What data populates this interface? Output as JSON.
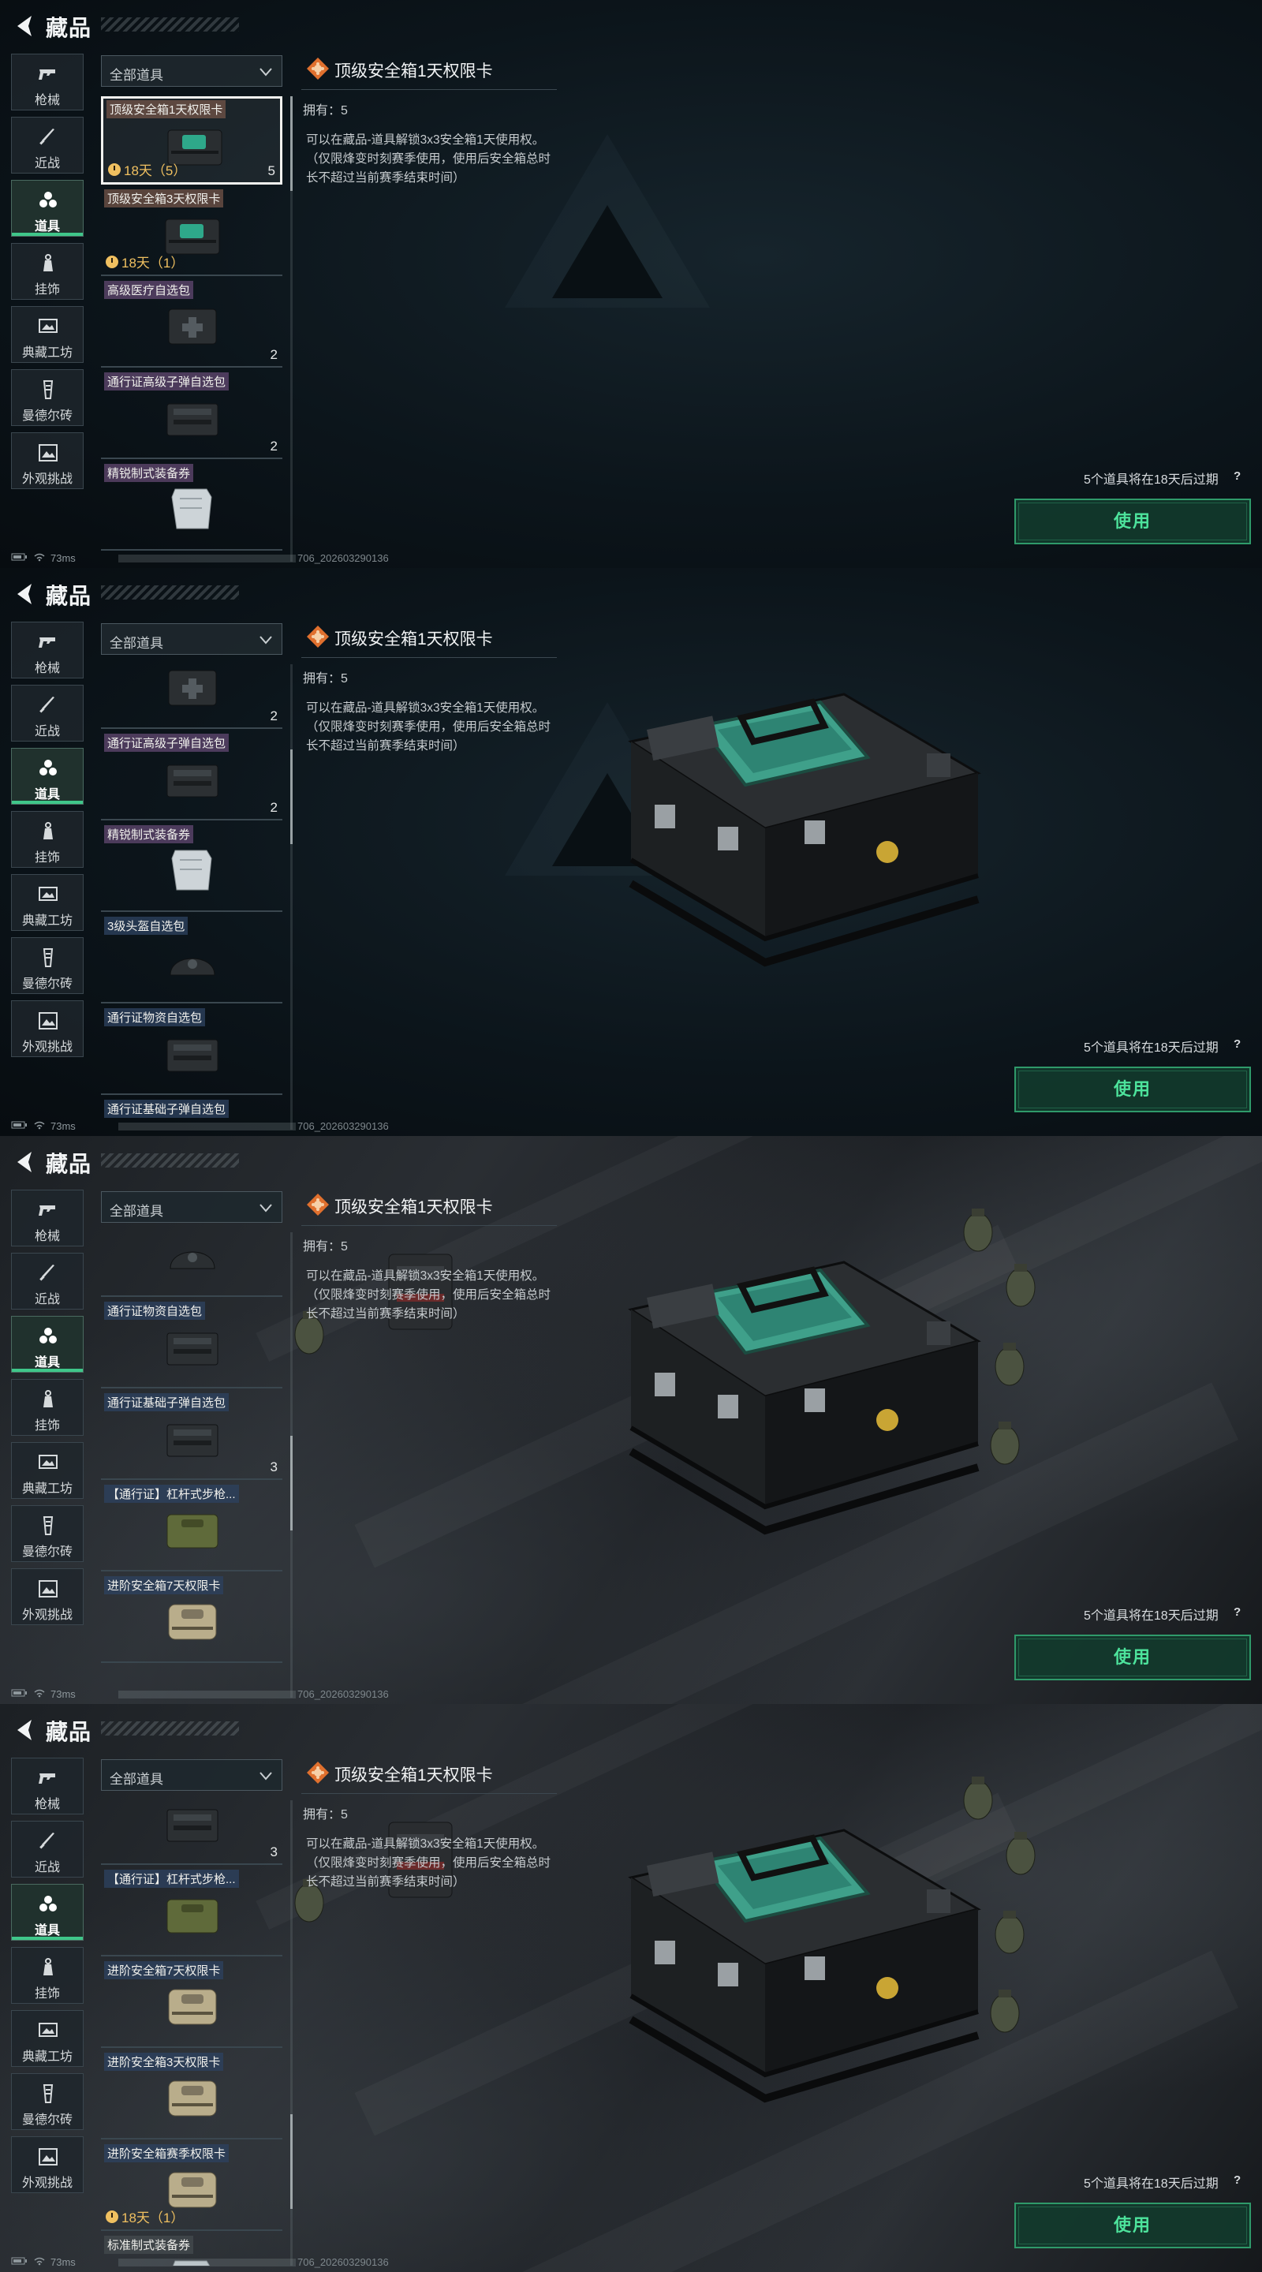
{
  "header": {
    "title": "藏品"
  },
  "categories": [
    {
      "label": "枪械",
      "icon": "gun-icon"
    },
    {
      "label": "近战",
      "icon": "knife-icon"
    },
    {
      "label": "道具",
      "icon": "items-icon",
      "active": true
    },
    {
      "label": "挂饰",
      "icon": "charm-icon"
    },
    {
      "label": "典藏工坊",
      "icon": "workshop-icon"
    },
    {
      "label": "曼德尔砖",
      "icon": "mandel-brick-icon"
    },
    {
      "label": "外观挑战",
      "icon": "appearance-challenge-icon"
    }
  ],
  "filter": {
    "label": "全部道具"
  },
  "detail": {
    "title": "顶级安全箱1天权限卡",
    "own": "拥有：5",
    "description": "可以在藏品-道具解锁3x3安全箱1天使用权。（仅限烽变时刻赛季使用，使用后安全箱总时长不超过当前赛季结束时间）"
  },
  "footer": {
    "expire_note": "5个道具将在18天后过期",
    "help": "?",
    "use_label": "使用"
  },
  "status": {
    "ping": "73ms",
    "id": "706_202603290136"
  },
  "lists": [
    [
      {
        "name": "顶级安全箱1天权限卡",
        "quality": "orange",
        "timer": "18天（5）",
        "count": "5",
        "selected": true,
        "img": "case-green"
      },
      {
        "name": "顶级安全箱3天权限卡",
        "quality": "orange",
        "timer": "18天（1）",
        "count": "",
        "img": "case-green"
      },
      {
        "name": "高级医疗自选包",
        "quality": "purple",
        "count": "2",
        "img": "med"
      },
      {
        "name": "通行证高级子弹自选包",
        "quality": "purple",
        "count": "2",
        "img": "ammo"
      },
      {
        "name": "精锐制式装备券",
        "quality": "purple",
        "count": "",
        "img": "ticket"
      }
    ],
    [
      {
        "name": "",
        "quality": "purple",
        "count": "2",
        "img": "med",
        "partial": true
      },
      {
        "name": "通行证高级子弹自选包",
        "quality": "purple",
        "count": "2",
        "img": "ammo"
      },
      {
        "name": "精锐制式装备券",
        "quality": "purple",
        "count": "",
        "img": "ticket"
      },
      {
        "name": "3级头盔自选包",
        "quality": "blue",
        "count": "",
        "img": "helmet"
      },
      {
        "name": "通行证物资自选包",
        "quality": "blue",
        "count": "",
        "img": "ammo"
      },
      {
        "name": "通行证基础子弹自选包",
        "quality": "blue",
        "count": "",
        "img": "ammo"
      }
    ],
    [
      {
        "name": "3级头盔自选包",
        "quality": "blue",
        "count": "",
        "img": "helmet"
      },
      {
        "name": "通行证物资自选包",
        "quality": "blue",
        "count": "",
        "img": "ammo"
      },
      {
        "name": "通行证基础子弹自选包",
        "quality": "blue",
        "count": "3",
        "img": "ammo"
      },
      {
        "name": "【通行证】杠杆式步枪...",
        "quality": "blue",
        "count": "",
        "img": "case-olive"
      },
      {
        "name": "进阶安全箱7天权限卡",
        "quality": "blue",
        "count": "",
        "img": "case-tan"
      }
    ],
    [
      {
        "name": "",
        "quality": "blue",
        "count": "3",
        "img": "ammo",
        "partial": true
      },
      {
        "name": "【通行证】杠杆式步枪...",
        "quality": "blue",
        "count": "",
        "img": "case-olive"
      },
      {
        "name": "进阶安全箱7天权限卡",
        "quality": "blue",
        "count": "",
        "img": "case-tan"
      },
      {
        "name": "进阶安全箱3天权限卡",
        "quality": "blue",
        "count": "",
        "img": "case-tan"
      },
      {
        "name": "进阶安全箱赛季权限卡",
        "quality": "blue",
        "timer": "18天（1）",
        "count": "",
        "img": "case-tan"
      },
      {
        "name": "标准制式装备券",
        "quality": "grey",
        "count": "",
        "img": "ticket"
      }
    ]
  ],
  "colors": {
    "accent_green": "#3fc78a",
    "timer_gold": "#f0c060",
    "use_text": "#4de39c"
  }
}
